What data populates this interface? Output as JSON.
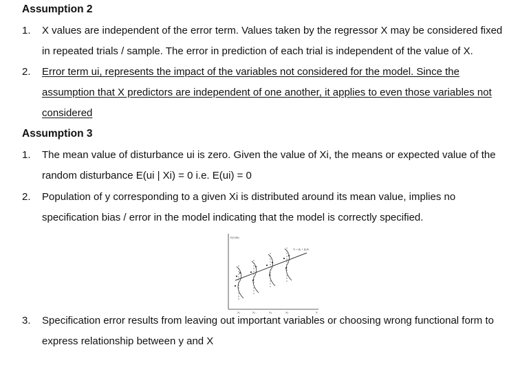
{
  "assumption2": {
    "heading": "Assumption 2",
    "items": [
      {
        "number": "1.",
        "lines": [
          "X values are independent of the error term. Values taken by the regressor X may be considered fixed",
          "in repeated trials / sample. The error in prediction of each trial is independent of the value of X."
        ]
      },
      {
        "number": "2.",
        "lines": [
          "Error term ui, represents the impact of the variables not considered for the model. Since the",
          "assumption that X predictors are independent of one another, it applies to even those variables not",
          "considered"
        ]
      }
    ]
  },
  "assumption3": {
    "heading": "Assumption 3",
    "items": [
      {
        "number": "1.",
        "lines": [
          "The mean value of disturbance ui is zero. Given the value of Xi, the means or expected value of the",
          "random disturbance E(ui | Xi) = 0 i.e. E(ui) = 0"
        ]
      },
      {
        "number": "2.",
        "lines": [
          "Population of y corresponding to a given Xi is distributed around its mean value, implies no",
          "specification bias / error in the model indicating that the model is correctly specified."
        ]
      },
      {
        "number": "3.",
        "lines": [
          "Specification error results from leaving out important variables or choosing wrong functional form to",
          "express relationship between y and X"
        ]
      }
    ]
  },
  "figure": {
    "y_label": "E(Y|Xi)",
    "line_label": "Yᵢ = β₁ + β₂Xᵢ",
    "x_ticks": [
      "X₁",
      "X₂",
      "X₃",
      "X₄"
    ],
    "x_label": "X"
  }
}
